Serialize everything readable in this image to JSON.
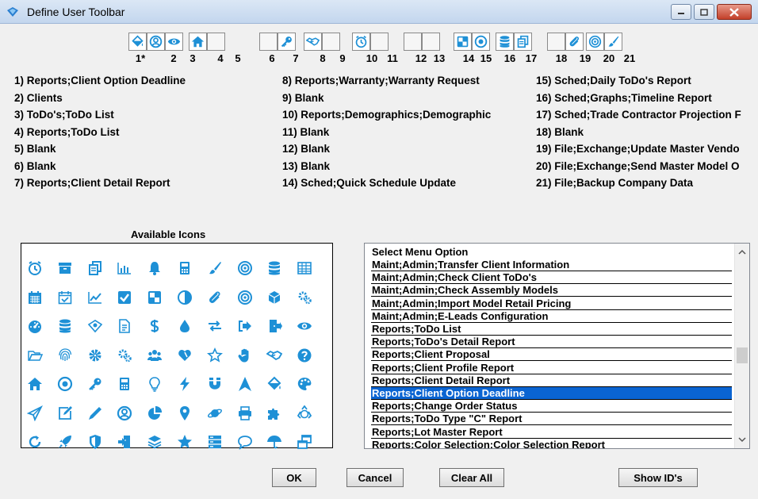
{
  "window": {
    "title": "Define User Toolbar"
  },
  "toolbar_numbers": [
    "1*",
    "2",
    "3",
    "4",
    "5",
    "6",
    "7",
    "8",
    "9",
    "10",
    "11",
    "12",
    "13",
    "14",
    "15",
    "16",
    "17",
    "18",
    "19",
    "20",
    "21"
  ],
  "toolbar_icons": [
    "paint-bucket-icon",
    "user-circle-icon",
    "eye-icon",
    "home-icon",
    "",
    "",
    "key-icon",
    "handshake-icon",
    "",
    "clock-icon",
    "",
    "",
    "",
    "contrast-square-icon",
    "compass-icon",
    "database-icon",
    "copy-icon",
    "",
    "paperclip-icon",
    "target-icon",
    "brush-icon"
  ],
  "assignments": {
    "col1": [
      "1) Reports;Client Option Deadline",
      "2) Clients",
      "3) ToDo's;ToDo List",
      "4) Reports;ToDo List",
      "5) Blank",
      "6) Blank",
      "7) Reports;Client Detail Report"
    ],
    "col2": [
      "8) Reports;Warranty;Warranty Request",
      "9) Blank",
      "10) Reports;Demographics;Demographic",
      "11) Blank",
      "12) Blank",
      "13) Blank",
      "14) Sched;Quick Schedule Update"
    ],
    "col3": [
      "15) Sched;Daily ToDo's Report",
      "16) Sched;Graphs;Timeline Report",
      "17) Sched;Trade Contractor Projection F",
      "18) Blank",
      "19) File;Exchange;Update Master Vendo",
      "20) File;Exchange;Send Master Model O",
      "21) File;Backup Company Data"
    ]
  },
  "available_icons_title": "Available Icons",
  "available_icons": [
    [
      "clock-icon",
      "archive-icon",
      "copy-icon",
      "bar-chart-icon",
      "bell-icon",
      "calculator-icon",
      "brush-icon",
      "target-icon",
      "database-icon",
      "table-icon"
    ],
    [
      "calendar-icon",
      "calendar-check-icon",
      "line-chart-icon",
      "checkbox-icon",
      "contrast-square-icon",
      "half-circle-icon",
      "paperclip-icon",
      "target-icon",
      "cube-icon",
      "gears-icon"
    ],
    [
      "dashboard-icon",
      "database-icon",
      "diamond-eye-icon",
      "document-icon",
      "dollar-icon",
      "drop-icon",
      "exchange-icon",
      "sign-out-icon",
      "door-exit-icon",
      "eye-icon"
    ],
    [
      "folder-open-icon",
      "fingerprint-icon",
      "gear-icon",
      "gears-icon",
      "group-icon",
      "heart-icon",
      "star-outline-icon",
      "hand-icon",
      "handshake-icon",
      "help-icon"
    ],
    [
      "home-icon",
      "compass-icon",
      "key-icon",
      "calculator-icon",
      "lightbulb-icon",
      "lightning-icon",
      "magnet-icon",
      "navigation-icon",
      "paint-bucket-icon",
      "palette-icon"
    ],
    [
      "paper-plane-icon",
      "edit-icon",
      "pencil-icon",
      "user-circle-icon",
      "pie-chart-icon",
      "map-pin-icon",
      "planet-icon",
      "printer-icon",
      "puzzle-icon",
      "recycle-icon"
    ],
    [
      "refresh-icon",
      "rocket-icon",
      "shield-icon",
      "sign-in-icon",
      "layers-icon",
      "star-icon",
      "server-icon",
      "chat-icon",
      "umbrella-icon",
      "windows-icon"
    ]
  ],
  "menu_list": {
    "header": "Select Menu Option",
    "items": [
      "Maint;Admin;Transfer Client Information",
      "Maint;Admin;Check Client ToDo's",
      "Maint;Admin;Check Assembly Models",
      "Maint;Admin;Import Model Retail Pricing",
      "Maint;Admin;E-Leads Configuration",
      "Reports;ToDo List",
      "Reports;ToDo's Detail Report",
      "Reports;Client Proposal",
      "Reports;Client Profile Report",
      "Reports;Client Detail Report",
      "Reports;Client Option Deadline",
      "Reports;Change Order Status",
      "Reports;ToDo Type \"C\" Report",
      "Reports;Lot Master Report",
      "Reports;Color Selection;Color Selection Report"
    ],
    "selected_index": 10
  },
  "buttons": {
    "ok": "OK",
    "cancel": "Cancel",
    "clear_all": "Clear All",
    "show_ids": "Show ID's"
  },
  "colors": {
    "icon_blue": "#1e90d6",
    "selection": "#0a64d2"
  }
}
